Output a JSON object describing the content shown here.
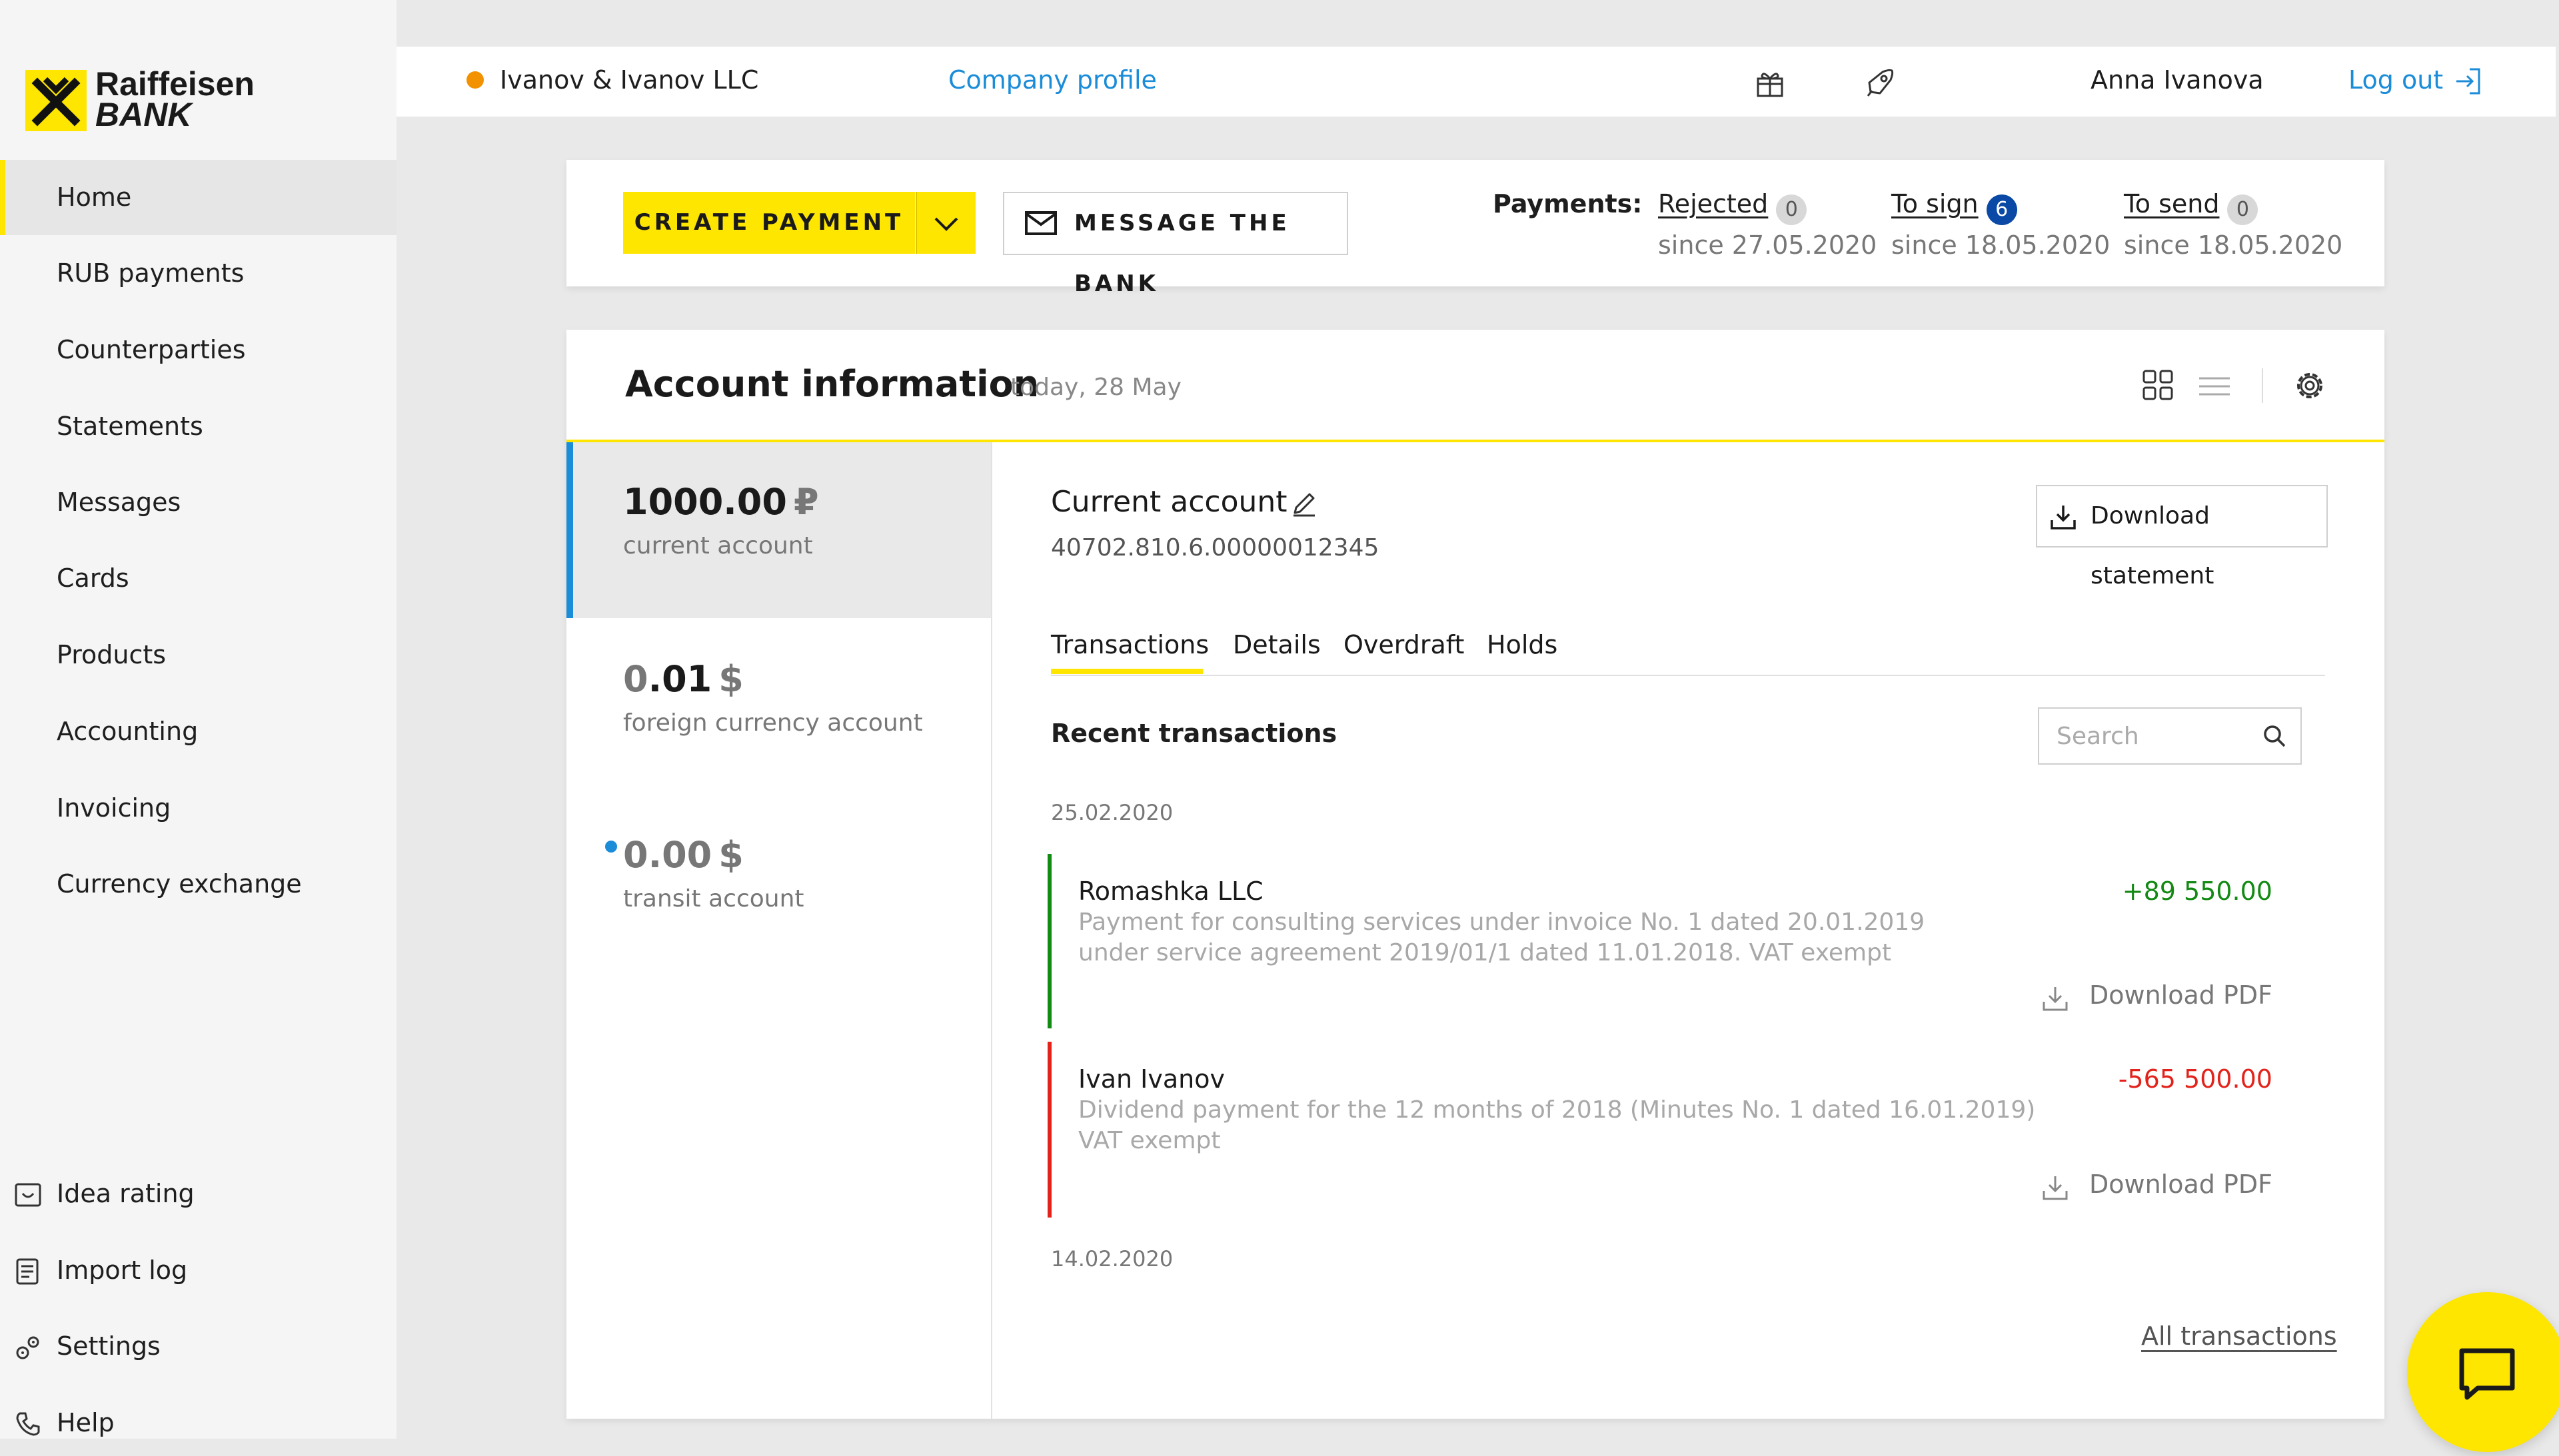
{
  "brand": {
    "line1": "Raiffeisen",
    "line2": "BANK",
    "color_yellow": "#fee600"
  },
  "sidebar": {
    "items": [
      {
        "label": "Home",
        "active": true
      },
      {
        "label": "RUB payments"
      },
      {
        "label": "Counterparties"
      },
      {
        "label": "Statements"
      },
      {
        "label": "Messages"
      },
      {
        "label": "Cards"
      },
      {
        "label": "Products"
      },
      {
        "label": "Accounting"
      },
      {
        "label": "Invoicing"
      },
      {
        "label": "Currency exchange"
      }
    ],
    "bottom": [
      {
        "label": "Idea rating",
        "icon": "idea-rating-icon"
      },
      {
        "label": "Import log",
        "icon": "import-log-icon"
      },
      {
        "label": "Settings",
        "icon": "settings-gears-icon"
      },
      {
        "label": "Help",
        "icon": "phone-icon"
      }
    ]
  },
  "header": {
    "company": "Ivanov & Ivanov LLC",
    "company_status_color": "#f39200",
    "profile_link": "Company profile",
    "user_name": "Anna Ivanova",
    "logout": "Log out",
    "link_color": "#1a8cd8"
  },
  "actions": {
    "create_payment": "CREATE PAYMENT",
    "message_bank": "MESSAGE THE BANK",
    "payments_label": "Payments:",
    "groups": [
      {
        "title": "Rejected",
        "count": "0",
        "since": "since 27.05.2020"
      },
      {
        "title": "To sign",
        "count": "6",
        "since": "since 18.05.2020",
        "highlight": true
      },
      {
        "title": "To send",
        "count": "0",
        "since": "since 18.05.2020"
      }
    ]
  },
  "account_info": {
    "title": "Account information",
    "date": "today, 28 May",
    "accounts": [
      {
        "amount": "1000.00",
        "currency": "₽",
        "label": "current account",
        "active": true
      },
      {
        "amount_dim": "0",
        "amount_rest": ".01",
        "currency": "$",
        "label": "foreign currency account"
      },
      {
        "amount": "0.00",
        "currency": "$",
        "label": "transit account",
        "dot": true
      }
    ],
    "detail": {
      "title": "Current account",
      "number": "40702.810.6.00000012345",
      "download_statement": "Download statement",
      "tabs": [
        "Transactions",
        "Details",
        "Overdraft",
        "Holds"
      ],
      "active_tab": "Transactions",
      "recent_title": "Recent transactions",
      "search_placeholder": "Search",
      "dates": [
        "25.02.2020",
        "14.02.2020"
      ],
      "transactions": [
        {
          "name": "Romashka LLC",
          "desc_line1": "Payment for consulting services under invoice No. 1 dated 20.01.2019",
          "desc_line2": "under service agreement 2019/01/1 dated 11.01.2018. VAT exempt",
          "amount": "+89 550.00",
          "color": "#138a13",
          "pdf": "Download PDF"
        },
        {
          "name": "Ivan Ivanov",
          "desc_line1": "Dividend payment for the 12 months of 2018 (Minutes No. 1 dated 16.01.2019)",
          "desc_line2": "VAT exempt",
          "amount": "-565 500.00",
          "color": "#e3231b",
          "pdf": "Download PDF"
        }
      ],
      "all_transactions": "All transactions"
    }
  }
}
